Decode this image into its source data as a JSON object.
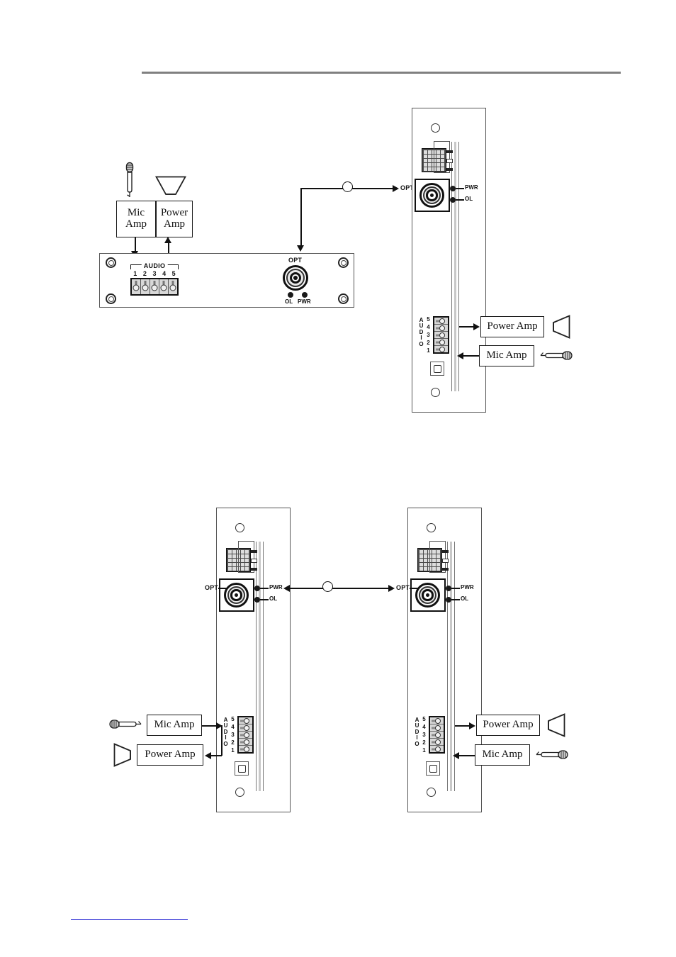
{
  "document": {
    "header_rule": true,
    "footer_link_text": ""
  },
  "figures": [
    {
      "id": "figure-top",
      "description": "Audio transmitter front panel connected by optical fiber to receiver card",
      "units": [
        {
          "id": "horizontal-panel",
          "type": "rack-front-panel",
          "labels": {
            "audio_bracket": "AUDIO",
            "audio_pins": [
              "1",
              "2",
              "3",
              "4",
              "5"
            ],
            "opt": "OPT",
            "led_left": "OL",
            "led_right": "PWR"
          }
        },
        {
          "id": "vertical-card-top",
          "type": "plug-in-card",
          "labels": {
            "opt": "OPT",
            "led_top": "PWR",
            "led_bottom": "OL",
            "audio_word": "AUDIO",
            "audio_pins": [
              "5",
              "4",
              "3",
              "2",
              "1"
            ]
          }
        }
      ],
      "blocks": [
        {
          "id": "panel-mic-amp",
          "line1": "Mic",
          "line2": "Amp",
          "icon": "microphone-icon"
        },
        {
          "id": "panel-power-amp",
          "line1": "Power",
          "line2": "Amp",
          "icon": "speaker-icon"
        },
        {
          "id": "card-power-amp",
          "label": "Power Amp",
          "icon": "speaker-icon"
        },
        {
          "id": "card-mic-amp",
          "label": "Mic Amp",
          "icon": "microphone-icon"
        }
      ]
    },
    {
      "id": "figure-bottom",
      "description": "Two plug-in cards linked back to back over optical fiber",
      "units": [
        {
          "id": "vertical-card-left",
          "type": "plug-in-card",
          "labels": {
            "opt": "OPT",
            "led_top": "PWR",
            "led_bottom": "OL",
            "audio_word": "AUDIO",
            "audio_pins": [
              "5",
              "4",
              "3",
              "2",
              "1"
            ]
          }
        },
        {
          "id": "vertical-card-right",
          "type": "plug-in-card",
          "labels": {
            "opt": "OPT",
            "led_top": "PWR",
            "led_bottom": "OL",
            "audio_word": "AUDIO",
            "audio_pins": [
              "5",
              "4",
              "3",
              "2",
              "1"
            ]
          }
        }
      ],
      "blocks": [
        {
          "id": "left-mic-amp",
          "label": "Mic Amp",
          "icon": "microphone-icon"
        },
        {
          "id": "left-power-amp",
          "label": "Power Amp",
          "icon": "speaker-icon"
        },
        {
          "id": "right-power-amp",
          "label": "Power Amp",
          "icon": "speaker-icon"
        },
        {
          "id": "right-mic-amp",
          "label": "Mic Amp",
          "icon": "microphone-icon"
        }
      ]
    }
  ]
}
